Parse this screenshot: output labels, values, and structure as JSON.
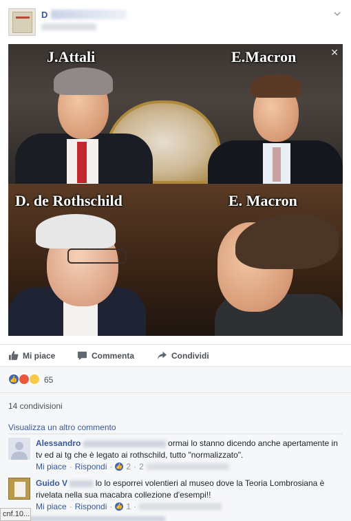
{
  "post": {
    "author_initial": "D",
    "photo_labels": {
      "top_left": "J.Attali",
      "top_right": "E.Macron",
      "bottom_left": "D. de Rothschild",
      "bottom_right": "E. Macron"
    },
    "close_glyph": "✕"
  },
  "actions": {
    "like": "Mi piace",
    "comment": "Commenta",
    "share": "Condividi"
  },
  "reactions": {
    "count": "65",
    "icons": [
      "like-icon",
      "angry-icon",
      "haha-icon"
    ],
    "colors": {
      "like": "#4267b2",
      "angry": "#e9573f",
      "haha": "#f7c948"
    }
  },
  "shares": {
    "label": "14 condivisioni"
  },
  "comments": {
    "view_more": "Visualizza un altro commento",
    "items": [
      {
        "name": "Alessandro",
        "text": "ormai lo stanno dicendo anche apertamente in tv ed ai tg che è legato ai rothschild, tutto \"normalizzato\".",
        "like": "Mi piace",
        "reply": "Rispondi",
        "likes": "2",
        "date_partial": "2"
      },
      {
        "name": "Guido V",
        "text": "lo lo esporrei volentieri al museo dove la Teoria Lombrosiana è rivelata nella sua macabra collezione d'esempi!!",
        "like": "Mi piace",
        "reply": "Rispondi",
        "likes": "1"
      }
    ]
  },
  "status_tooltip": "cnf.10..."
}
